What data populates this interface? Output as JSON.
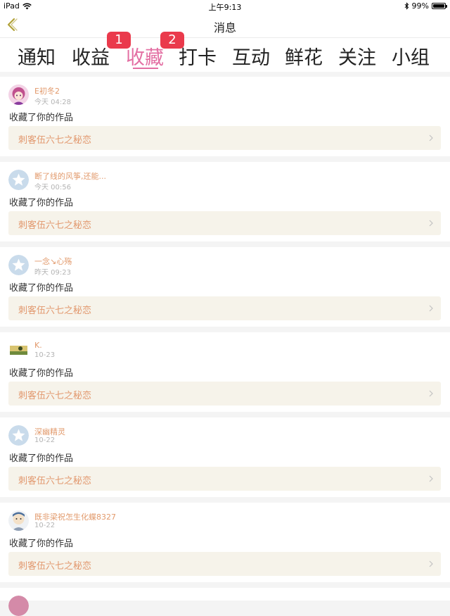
{
  "status_bar": {
    "device": "iPad",
    "time": "上午9:13",
    "battery": "99%",
    "battery_level": 0.99
  },
  "nav": {
    "title": "消息"
  },
  "tabs": [
    {
      "label": "通知",
      "active": false,
      "badge": ""
    },
    {
      "label": "收益",
      "active": false,
      "badge": "1"
    },
    {
      "label": "收藏",
      "active": true,
      "badge": ""
    },
    {
      "label": "打卡",
      "active": false,
      "badge": "2"
    },
    {
      "label": "互动",
      "active": false,
      "badge": ""
    },
    {
      "label": "鲜花",
      "active": false,
      "badge": ""
    },
    {
      "label": "关注",
      "active": false,
      "badge": ""
    },
    {
      "label": "小组",
      "active": false,
      "badge": ""
    }
  ],
  "feed": [
    {
      "user": "E初冬2",
      "time": "今天 04:28",
      "avatar": "anime-girl",
      "action": "收藏了你的作品",
      "work": "刺客伍六七之秘恋"
    },
    {
      "user": "断了线的风筝,还能...",
      "time": "今天 00:56",
      "avatar": "default-star",
      "action": "收藏了你的作品",
      "work": "刺客伍六七之秘恋"
    },
    {
      "user": "一念↘心殇",
      "time": "昨天 09:23",
      "avatar": "default-star",
      "action": "收藏了你的作品",
      "work": "刺客伍六七之秘恋"
    },
    {
      "user": "K.",
      "time": "10-23",
      "avatar": "landscape-photo",
      "action": "收藏了你的作品",
      "work": "刺客伍六七之秘恋"
    },
    {
      "user": "深幽精灵",
      "time": "10-22",
      "avatar": "default-star",
      "action": "收藏了你的作品",
      "work": "刺客伍六七之秘恋"
    },
    {
      "user": "既非梁祝怎生化蝶8327",
      "time": "10-22",
      "avatar": "cartoon-character",
      "action": "收藏了你的作品",
      "work": "刺客伍六七之秘恋"
    }
  ],
  "colors": {
    "accent": "#e36fa3",
    "badge": "#ea3a4c",
    "username": "#e29a6c",
    "work_bg": "#f6f3ea",
    "back_icon": "#b2a23a"
  }
}
